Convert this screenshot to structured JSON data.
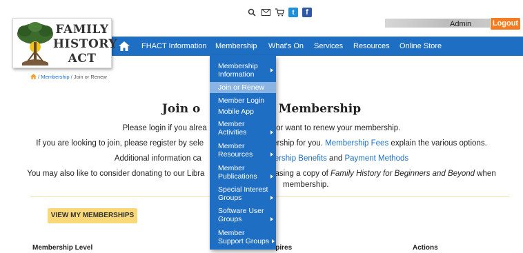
{
  "topbar": {
    "icons": [
      "search-icon",
      "mail-icon",
      "cart-icon",
      "twitter-icon",
      "facebook-icon"
    ],
    "admin_label": "Admin",
    "logout_label": "Logout"
  },
  "logo": {
    "line1": "FAMILY",
    "line2": "HISTORY",
    "line3": "ACT"
  },
  "nav": {
    "items": [
      "FHACT Information",
      "Membership",
      "What's On",
      "Services",
      "Resources",
      "Online Store"
    ]
  },
  "breadcrumb": {
    "sep": "/",
    "parent": "Membership",
    "current": "Join or Renew"
  },
  "main": {
    "title_left": "Join o",
    "title_right": "ur Membership",
    "p1_left": "Please login if you alrea",
    "p1_right": "t or want to renew your membership.",
    "p2_left": "If you are looking to join, please register by sele",
    "p2_link1": "mbership for you.",
    "p2_link2": "Membership Fees",
    "p2_right": "explain the various options.",
    "p3_left": "Additional information ca",
    "p3_link1": "mbership Benefits",
    "p3_mid": "and",
    "p3_link2": "Payment Methods",
    "p4_left": "You may also like to consider donating to our Libra",
    "p4_right": "rchasing a copy of",
    "p4_italic": "Family History for Beginners and Beyond",
    "p4_end": "when",
    "p4_line2": "membership.",
    "view_button": "VIEW MY MEMBERSHIPS",
    "table_headers": {
      "level": "Membership Level",
      "expires": "Expires",
      "actions": "Actions"
    }
  },
  "dropdown": {
    "items": [
      {
        "label1": "Membership",
        "label2": "Information",
        "arrow": true
      },
      {
        "label1": "Join or Renew",
        "label2": "",
        "arrow": false,
        "selected": true
      },
      {
        "label1": "Member Login",
        "label2": "",
        "arrow": false
      },
      {
        "label1": "Mobile App",
        "label2": "",
        "arrow": false
      },
      {
        "label1": "Member",
        "label2": "Activities",
        "arrow": true
      },
      {
        "label1": "Member",
        "label2": "Resources",
        "arrow": true
      },
      {
        "label1": "Member",
        "label2": "Publications",
        "arrow": true
      },
      {
        "label1": "Special Interest",
        "label2": "Groups",
        "arrow": true
      },
      {
        "label1": "Software User",
        "label2": "Groups",
        "arrow": true
      },
      {
        "label1": "Member",
        "label2": "Support Groups",
        "arrow": true
      }
    ]
  },
  "colors": {
    "nav_blue": "#1e6fc4",
    "logout_orange": "#f47b20",
    "button_yellow": "#f8d878",
    "selected_item": "#8ab4e4"
  }
}
